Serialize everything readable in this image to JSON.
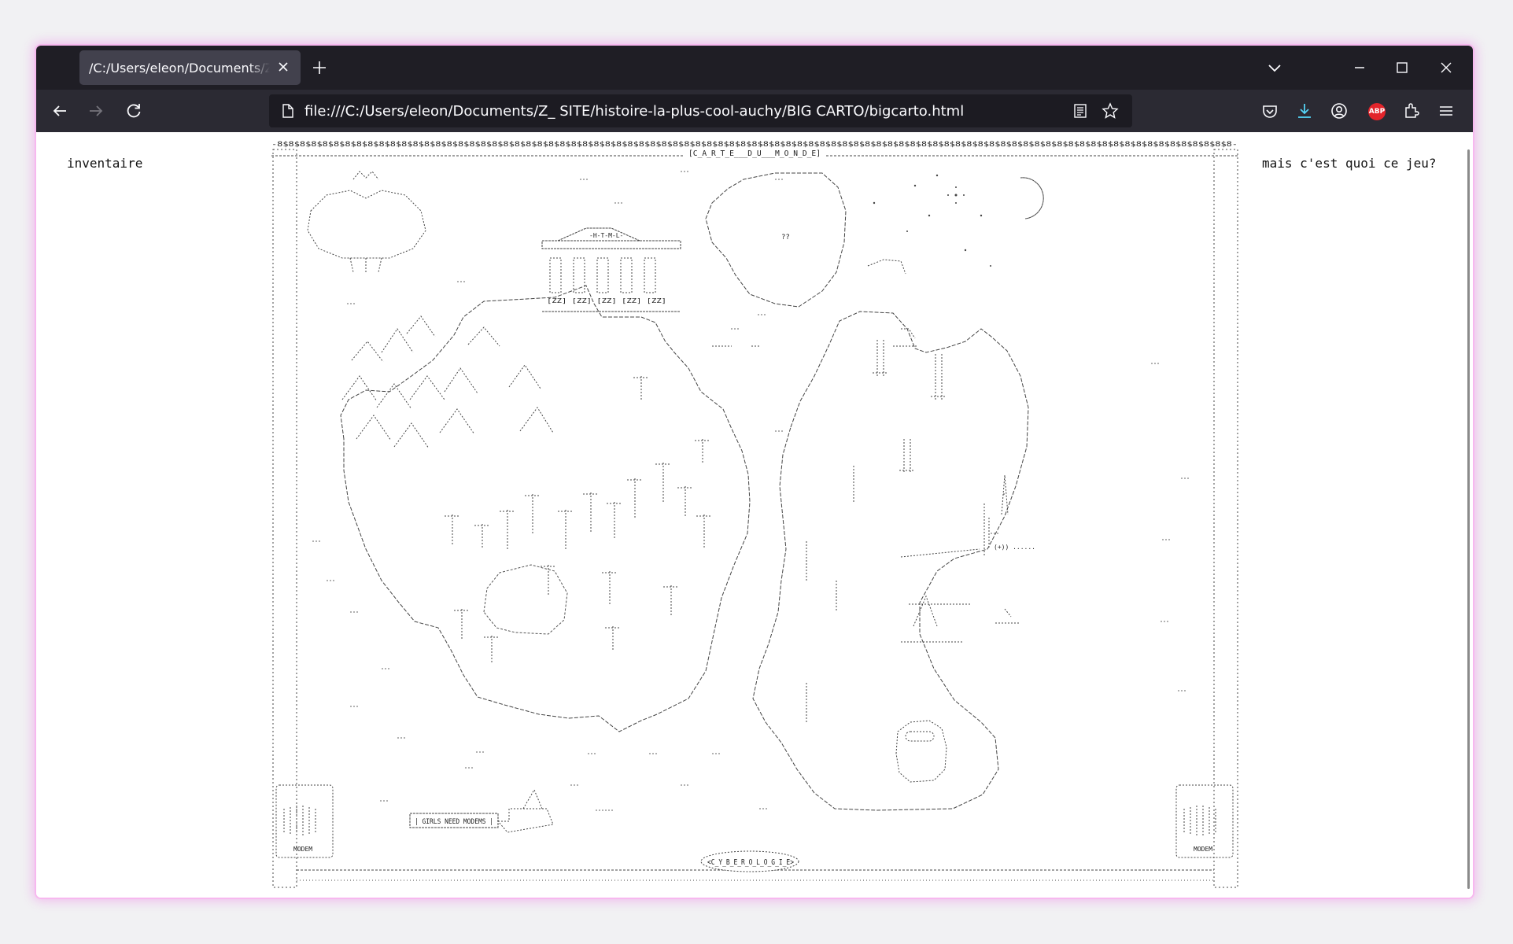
{
  "browser": {
    "tab_title": "/C:/Users/eleon/Documents/Z_%20",
    "url": "file:///C:/Users/eleon/Documents/Z_ SITE/histoire-la-plus-cool-auchy/BIG CARTO/bigcarto.html",
    "adblock_label": "ABP"
  },
  "page": {
    "left_link": "inventaire",
    "right_link": "mais c'est quoi ce jeu?"
  },
  "map": {
    "frame_top_pattern": "-8$8$8$8$8$8$8$8$8$8$8$8$8$8$8$8$8$8$8$8$8$8$8$8$8$8$8$8$8$8$8$8$8$8$8$8$8$8$8$8$8$8$8$8$8$8$8$8$8$8$8$8$8$8$8$8$8$8$8$8$8$8$8$8$8$8$8$8$8$8$8$8$8$8$8$8$8$8$8$8$8$8$8$8$8-",
    "title": "[C_A_R_T_E___D_U___M_O_N_D_E]",
    "footer_title": "<C_Y_B_E_R_O_L_O_G_I_E>",
    "temple_label": "-H-T-M-L-",
    "temple_base": "[ZZ]  [ZZ]  [ZZ]  [ZZ]  [ZZ]",
    "sign_text": "| GIRLS NEED MODEMS |",
    "modem_label": "MODEM",
    "question": "??",
    "dots": "(+)) ......"
  }
}
